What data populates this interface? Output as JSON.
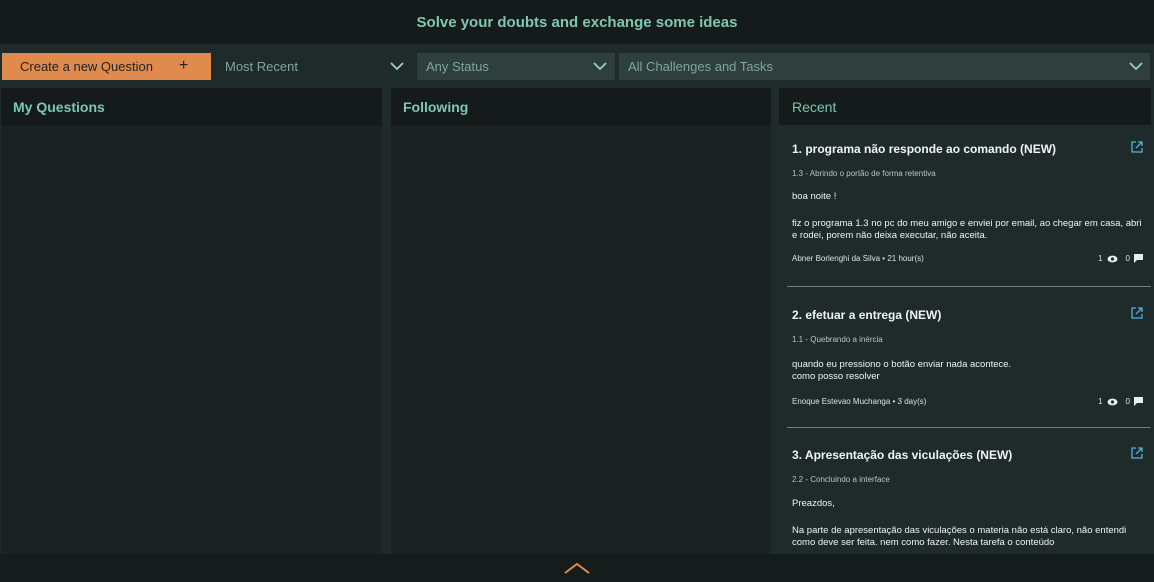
{
  "header": {
    "title": "Solve your doubts and exchange some ideas"
  },
  "filters": {
    "new_question_label": "Create a new Question",
    "new_question_icon": "plus-icon",
    "sort_selected": "Most Recent",
    "status_selected": "Any Status",
    "challenge_selected": "All Challenges and Tasks"
  },
  "columns": {
    "my_questions": "My Questions",
    "following": "Following",
    "recent": "Recent"
  },
  "recent_items": [
    {
      "title": "1. programa não responde ao comando (NEW)",
      "subtitle": "1.3 - Abrindo o portão de forma retentiva",
      "body1": "boa noite !",
      "body2": "fiz o programa 1.3 no pc do meu amigo e enviei por email, ao chegar em casa, abri e rodei, porem não deixa executar, não aceita.",
      "author": "Abner Borlenghi da Silva",
      "time": "• 21 hour(s)",
      "views": "1",
      "comments": "0"
    },
    {
      "title": "2. efetuar a entrega (NEW)",
      "subtitle": "1.1 - Quebrando a inércia",
      "body1": "quando eu pressiono o botão enviar nada acontece.",
      "body2": "como posso resolver",
      "author": "Enoque Estevao Muchanga",
      "time": "• 3 day(s)",
      "views": "1",
      "comments": "0"
    },
    {
      "title": "3. Apresentação das viculações (NEW)",
      "subtitle": "2.2 - Concluindo a interface",
      "body1": "Preazdos,",
      "body2": "Na parte de apresentação das viculações o materia não está claro, não entendi como deve ser feita. nem como fazer. Nesta tarefa o conteúdo"
    }
  ],
  "colors": {
    "accent": "#e08a4e",
    "heading": "#7fc7b3",
    "background": "#1f2b2a"
  }
}
